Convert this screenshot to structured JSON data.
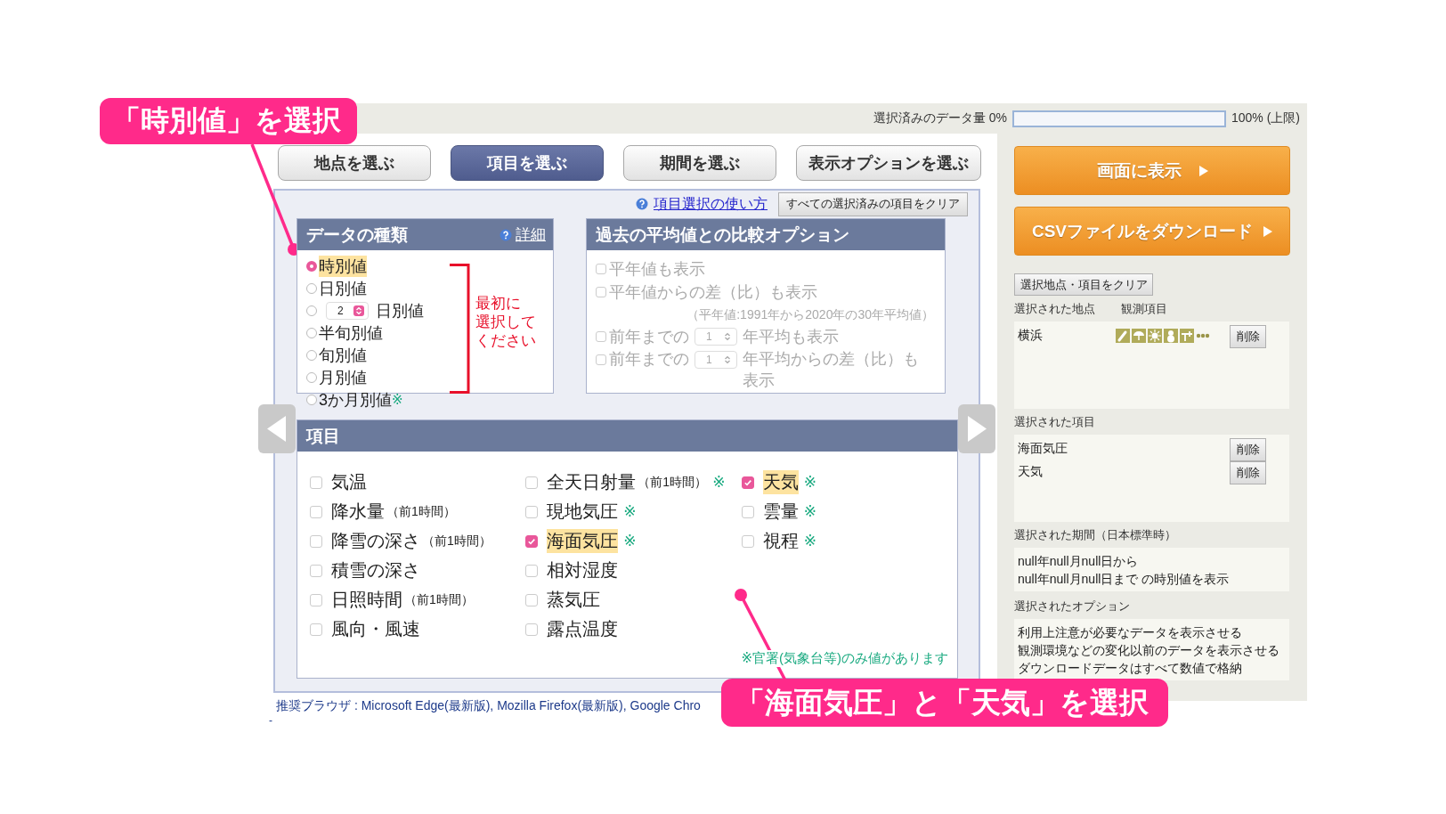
{
  "data_volume": {
    "label": "選択済みのデータ量 0%",
    "level": 0,
    "limit": "100% (上限)"
  },
  "tabs": [
    {
      "label": "地点を選ぶ",
      "selected": false
    },
    {
      "label": "項目を選ぶ",
      "selected": true
    },
    {
      "label": "期間を選ぶ",
      "selected": false
    },
    {
      "label": "表示オプションを選ぶ",
      "selected": false
    }
  ],
  "help_link": "項目選択の使い方",
  "clear_all_button": "すべての選択済みの項目をクリア",
  "data_type_panel": {
    "title": "データの種類",
    "detail_link": "詳細",
    "options": [
      {
        "kind": "radio",
        "label": "時別値",
        "selected": true
      },
      {
        "kind": "radio",
        "label": "日別値",
        "selected": false
      },
      {
        "kind": "spinner",
        "count": "2",
        "label": "日別値",
        "selected": false
      },
      {
        "kind": "radio",
        "label": "半旬別値",
        "selected": false
      },
      {
        "kind": "radio",
        "label": "旬別値",
        "selected": false
      },
      {
        "kind": "radio",
        "label": "月別値",
        "selected": false
      },
      {
        "kind": "radio",
        "label": "3か月別値",
        "note": "※",
        "selected": false
      }
    ],
    "instruction": [
      "最初に",
      "選択して",
      "ください"
    ]
  },
  "compare_panel": {
    "title": "過去の平均値との比較オプション",
    "disabled": true,
    "options": [
      {
        "kind": "checkbox",
        "label": "平年値も表示",
        "checked": false
      },
      {
        "kind": "checkbox",
        "label": "平年値からの差（比）も表示",
        "checked": false
      },
      {
        "kind": "note",
        "label": "（平年値:1991年から2020年の30年平均値）"
      },
      {
        "kind": "spinner",
        "prefix": "前年までの",
        "value": "1",
        "label": "年平均も表示",
        "checked": false
      },
      {
        "kind": "spinner",
        "prefix": "前年までの",
        "value": "1",
        "label": "年平均からの差（比）も表示",
        "checked": false
      }
    ]
  },
  "items_panel": {
    "title": "項目",
    "columns": [
      [
        {
          "label": "気温",
          "checked": false
        },
        {
          "label": "降水量",
          "sub": "（前1時間）",
          "checked": false
        },
        {
          "label": "降雪の深さ",
          "sub": "（前1時間）",
          "checked": false
        },
        {
          "label": "積雪の深さ",
          "checked": false
        },
        {
          "label": "日照時間",
          "sub": "（前1時間）",
          "checked": false
        },
        {
          "label": "風向・風速",
          "checked": false
        }
      ],
      [
        {
          "label": "全天日射量",
          "sub": "（前1時間）",
          "note": "※",
          "checked": false
        },
        {
          "label": "現地気圧",
          "note": "※",
          "checked": false
        },
        {
          "label": "海面気圧",
          "note": "※",
          "checked": true
        },
        {
          "label": "相対湿度",
          "checked": false
        },
        {
          "label": "蒸気圧",
          "checked": false
        },
        {
          "label": "露点温度",
          "checked": false
        }
      ],
      [
        {
          "label": "天気",
          "note": "※",
          "checked": true
        },
        {
          "label": "雲量",
          "note": "※",
          "checked": false
        },
        {
          "label": "視程",
          "note": "※",
          "checked": false
        }
      ]
    ],
    "footnote": "※官署(気象台等)のみ値があります"
  },
  "footer": "推奨ブラウザ : Microsoft Edge(最新版), Mozilla Firefox(最新版), Google Chro",
  "footer_dash": "-",
  "display_button": "画面に表示",
  "csv_button": "CSVファイルをダウンロード",
  "clear_selection_button": "選択地点・項目をクリア",
  "selected_stations": {
    "heading": "選択された地点",
    "column_heading": "観測項目",
    "rows": [
      {
        "name": "横浜",
        "delete": "削除"
      }
    ]
  },
  "selected_items": {
    "heading": "選択された項目",
    "rows": [
      {
        "name": "海面気圧",
        "delete": "削除"
      },
      {
        "name": "天気",
        "delete": "削除"
      }
    ]
  },
  "selected_period": {
    "heading": "選択された期間（日本標準時）",
    "lines": [
      "null年null月null日から",
      "null年null月null日まで の時別値を表示"
    ]
  },
  "selected_options": {
    "heading": "選択されたオプション",
    "lines": [
      "利用上注意が必要なデータを表示させる",
      "観測環境などの変化以前のデータを表示させる",
      "ダウンロードデータはすべて数値で格納"
    ]
  },
  "annotations": [
    {
      "text": "「時別値」を選択"
    },
    {
      "text": "「海面気圧」と「天気」を選択"
    }
  ]
}
